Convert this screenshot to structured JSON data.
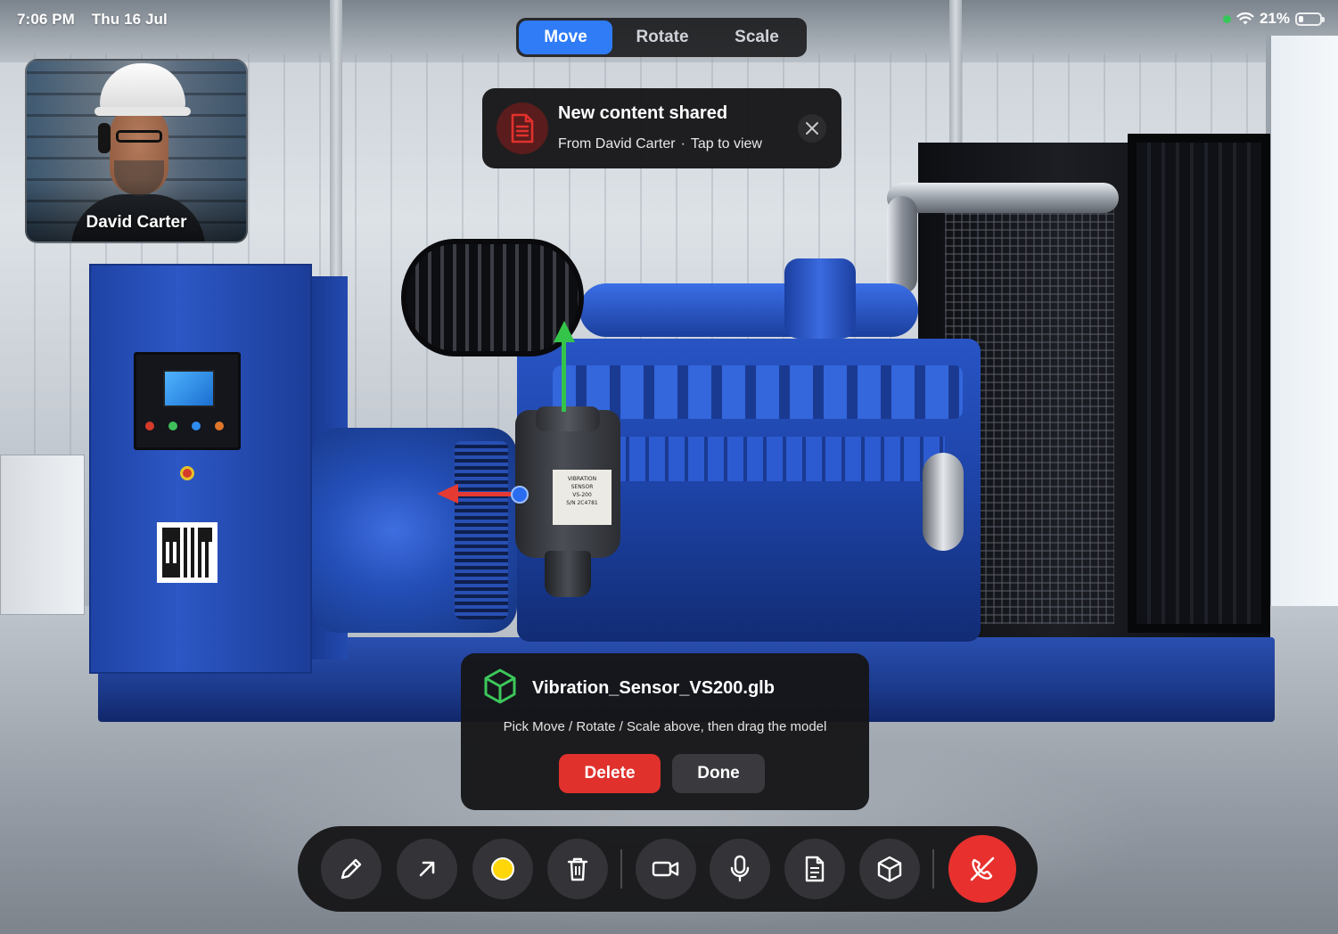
{
  "status_bar": {
    "time": "7:06 PM",
    "date": "Thu 16 Jul",
    "battery": "21%",
    "battery_level": 0.21,
    "icons": [
      "camera-in-use-dot",
      "wifi-icon",
      "battery-icon"
    ]
  },
  "transform_modes": {
    "selected": "Move",
    "items": [
      {
        "label": "Move"
      },
      {
        "label": "Rotate"
      },
      {
        "label": "Scale"
      }
    ],
    "accent_color": "#2f7cf6"
  },
  "participant": {
    "name": "David Carter"
  },
  "notification": {
    "title": "New content shared",
    "from": "From David Carter",
    "separator": "·",
    "action": "Tap to view",
    "icon": "document-icon",
    "icon_color": "#e0312d"
  },
  "model_panel": {
    "icon": "cube-icon",
    "icon_color": "#3cc85a",
    "filename": "Vibration_Sensor_VS200.glb",
    "hint": "Pick Move / Rotate / Scale above, then drag the model",
    "delete_label": "Delete",
    "done_label": "Done",
    "delete_color": "#e0312d"
  },
  "scene": {
    "sensor_label_lines": [
      "VIBRATION SENSOR",
      "VS-200",
      "S/N 2C4781"
    ],
    "gizmo_colors": {
      "y": "#35c44a",
      "x": "#e43a33",
      "z": "#2a6cf0"
    }
  },
  "toolbar": {
    "tools": [
      {
        "name": "draw-tool",
        "icon": "pencil-icon"
      },
      {
        "name": "arrow-tool",
        "icon": "arrow-up-right-icon"
      },
      {
        "name": "color-picker",
        "icon": "color-dot",
        "color": "#ffd60a"
      },
      {
        "name": "clear-tool",
        "icon": "trash-icon"
      },
      {
        "name": "camera-toggle",
        "icon": "video-camera-icon"
      },
      {
        "name": "mic-toggle",
        "icon": "microphone-icon"
      },
      {
        "name": "share-document",
        "icon": "document-icon"
      },
      {
        "name": "add-3d-model",
        "icon": "cube-icon"
      },
      {
        "name": "end-call",
        "icon": "phone-hangup-icon",
        "color": "#e8312e"
      }
    ]
  }
}
